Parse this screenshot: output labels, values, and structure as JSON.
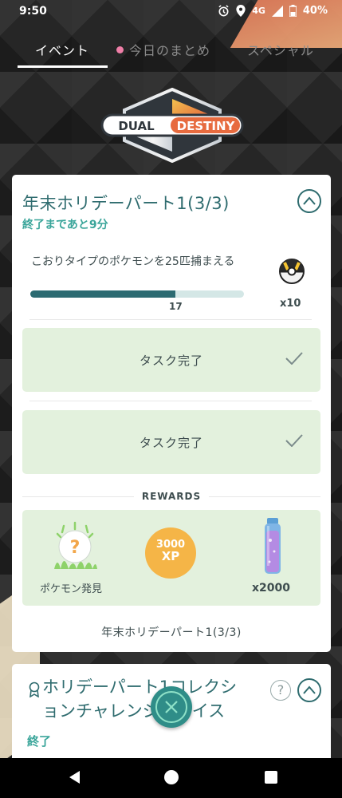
{
  "status_bar": {
    "time": "9:50",
    "network": "4G",
    "battery": "40%"
  },
  "tabs": [
    {
      "label": "イベント",
      "active": true
    },
    {
      "label": "今日のまとめ",
      "active": false
    },
    {
      "label": "スペシャル",
      "active": false
    }
  ],
  "logo": {
    "word1": "DUAL",
    "word2": "DESTINY"
  },
  "event_card": {
    "title": "年末ホリデーパート1(3/3)",
    "time_left": "終了まであと9分",
    "task": {
      "text": "こおりタイプのポケモンを25匹捕まえる",
      "progress_value": 17,
      "progress_goal": 25,
      "progress_label": "17",
      "reward_icon": "ultra-ball-icon",
      "reward_qty": "x10"
    },
    "completed_tasks": [
      {
        "label": "タスク完了"
      },
      {
        "label": "タスク完了"
      }
    ],
    "rewards_heading": "REWARDS",
    "rewards": {
      "encounter_label": "ポケモン発見",
      "xp_amount": "3000",
      "xp_unit": "XP",
      "stardust_qty": "x2000"
    },
    "footer": "年末ホリデーパート1(3/3)"
  },
  "collection_card": {
    "title": "ホリデーパート1コレクションチャレンジ：アイス",
    "status": "終了",
    "help_symbol": "?"
  },
  "colors": {
    "teal_text": "#2f6c6f",
    "green_text": "#3aa59a",
    "complete_bg": "#e3f1dd",
    "progress_fill": "#2c6b72",
    "xp_badge": "#f5b547"
  }
}
